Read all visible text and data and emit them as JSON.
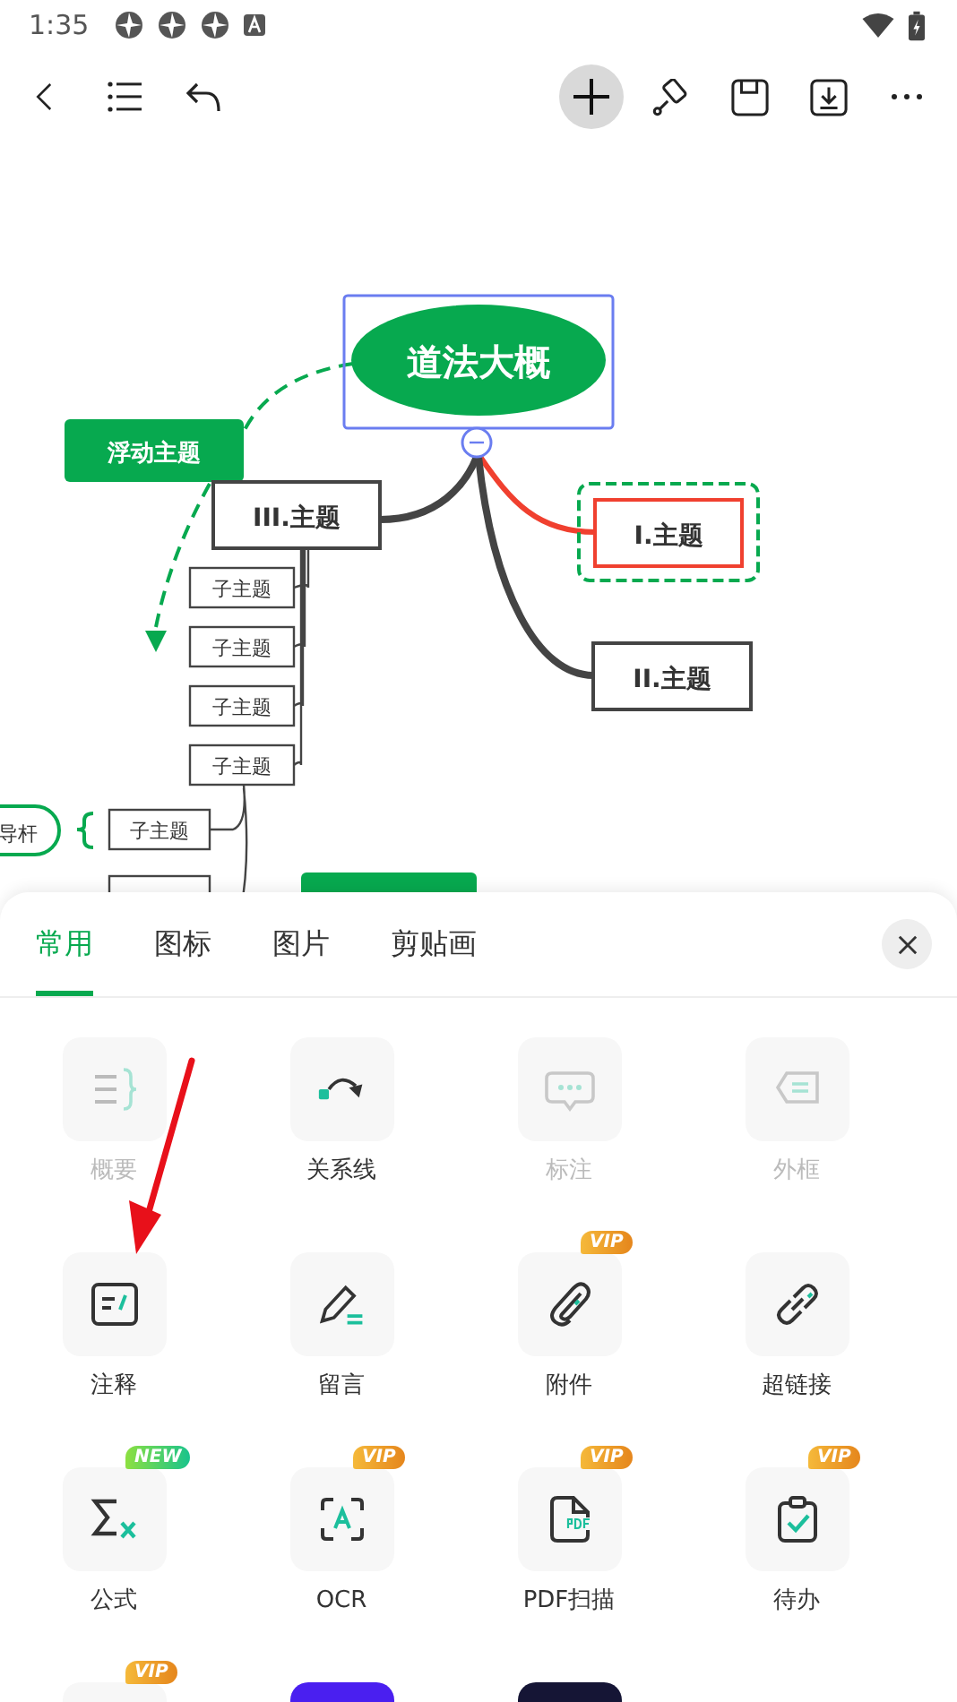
{
  "status_bar": {
    "time": "1:35"
  },
  "mind_map": {
    "central_topic": {
      "label": "道法大概",
      "selected": true
    },
    "floating_topic": {
      "label": "浮动主题"
    },
    "topics": [
      {
        "label": "III.主题",
        "highlighted": false
      },
      {
        "label": "I.主题",
        "highlighted": true
      },
      {
        "label": "II.主题",
        "highlighted": false
      }
    ],
    "subtopics": [
      "子主题",
      "子主题",
      "子主题",
      "子主题"
    ],
    "side_label": "导杆",
    "side_subtopic": "子主题"
  },
  "panel": {
    "tabs": [
      {
        "label": "常用",
        "selected": true
      },
      {
        "label": "图标",
        "selected": false
      },
      {
        "label": "图片",
        "selected": false
      },
      {
        "label": "剪贴画",
        "selected": false
      }
    ],
    "items": [
      {
        "kind": "summary",
        "label": "概要",
        "disabled": true
      },
      {
        "kind": "relation",
        "label": "关系线",
        "disabled": false
      },
      {
        "kind": "callout",
        "label": "标注",
        "disabled": true
      },
      {
        "kind": "boundary",
        "label": "外框",
        "disabled": true
      },
      {
        "kind": "note",
        "label": "注释",
        "disabled": false
      },
      {
        "kind": "comment",
        "label": "留言",
        "disabled": false
      },
      {
        "kind": "attachment",
        "label": "附件",
        "disabled": false,
        "badge": "VIP"
      },
      {
        "kind": "link",
        "label": "超链接",
        "disabled": false
      },
      {
        "kind": "formula",
        "label": "公式",
        "disabled": false,
        "badge": "NEW"
      },
      {
        "kind": "ocr",
        "label": "OCR",
        "disabled": false,
        "badge": "VIP"
      },
      {
        "kind": "pdf",
        "label": "PDF扫描",
        "disabled": false,
        "badge": "VIP"
      },
      {
        "kind": "todo",
        "label": "待办",
        "disabled": false,
        "badge": "VIP"
      },
      {
        "kind": "plain",
        "color": "#f7f7f7",
        "badge": "VIP"
      },
      {
        "kind": "plain",
        "color": "#4a1ff0"
      },
      {
        "kind": "plain",
        "color": "#151535"
      }
    ]
  }
}
